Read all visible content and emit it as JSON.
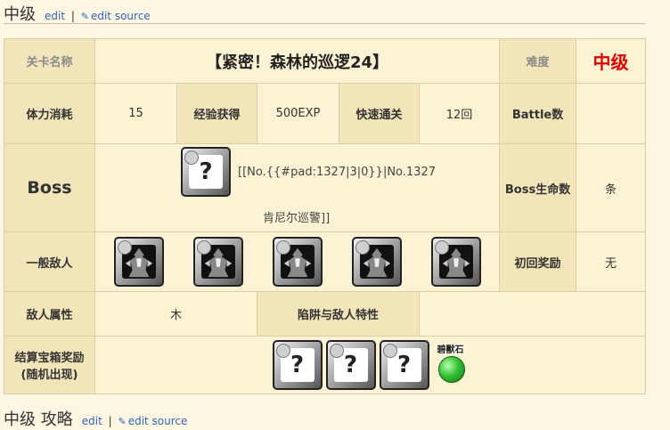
{
  "section_top": {
    "title": "中级",
    "edit": "edit",
    "sep": "|",
    "edit_source": "edit source"
  },
  "stage": {
    "name_label": "关卡名称",
    "name": "【紧密！森林的巡逻24】",
    "difficulty_label": "难度",
    "difficulty": "中级",
    "stamina_label": "体力消耗",
    "stamina": "15",
    "exp_label": "经验获得",
    "exp": "500EXP",
    "quick_label": "快速通关",
    "quick": "12回",
    "battles_label": "Battle数",
    "battles": "",
    "boss_label": "Boss",
    "boss_text_1": "[[No.{{#pad:1327|3|0}}|No.1327",
    "boss_text_2": "肯尼尔巡警]]",
    "boss_hp_label": "Boss生命数",
    "boss_hp": "条",
    "enemies_label": "一般敌人",
    "first_reward_label": "初回奖励",
    "first_reward": "无",
    "enemy_attr_label": "敌人属性",
    "enemy_attr": "木",
    "traps_label": "陷阱与敌人特性",
    "traps": "",
    "chest_label_1": "结算宝箱奖励",
    "chest_label_2": "(随机出现)",
    "gem_label": "碧獸石",
    "unknown_glyph": "?"
  },
  "section_bottom": {
    "title": "中级 攻略",
    "edit": "edit",
    "sep": "|",
    "edit_source": "edit source"
  },
  "colors": {
    "difficulty": "#e00000",
    "link": "#3366bb",
    "header_bg": "#f1e5b9",
    "cell_bg": "#fcf3d4"
  },
  "icons": {
    "edit_source": "pencil-icon",
    "boss": "question-mark-icon",
    "enemy": "dark-monster-icon",
    "reward": "question-mark-icon",
    "gem": "green-gem-icon"
  }
}
